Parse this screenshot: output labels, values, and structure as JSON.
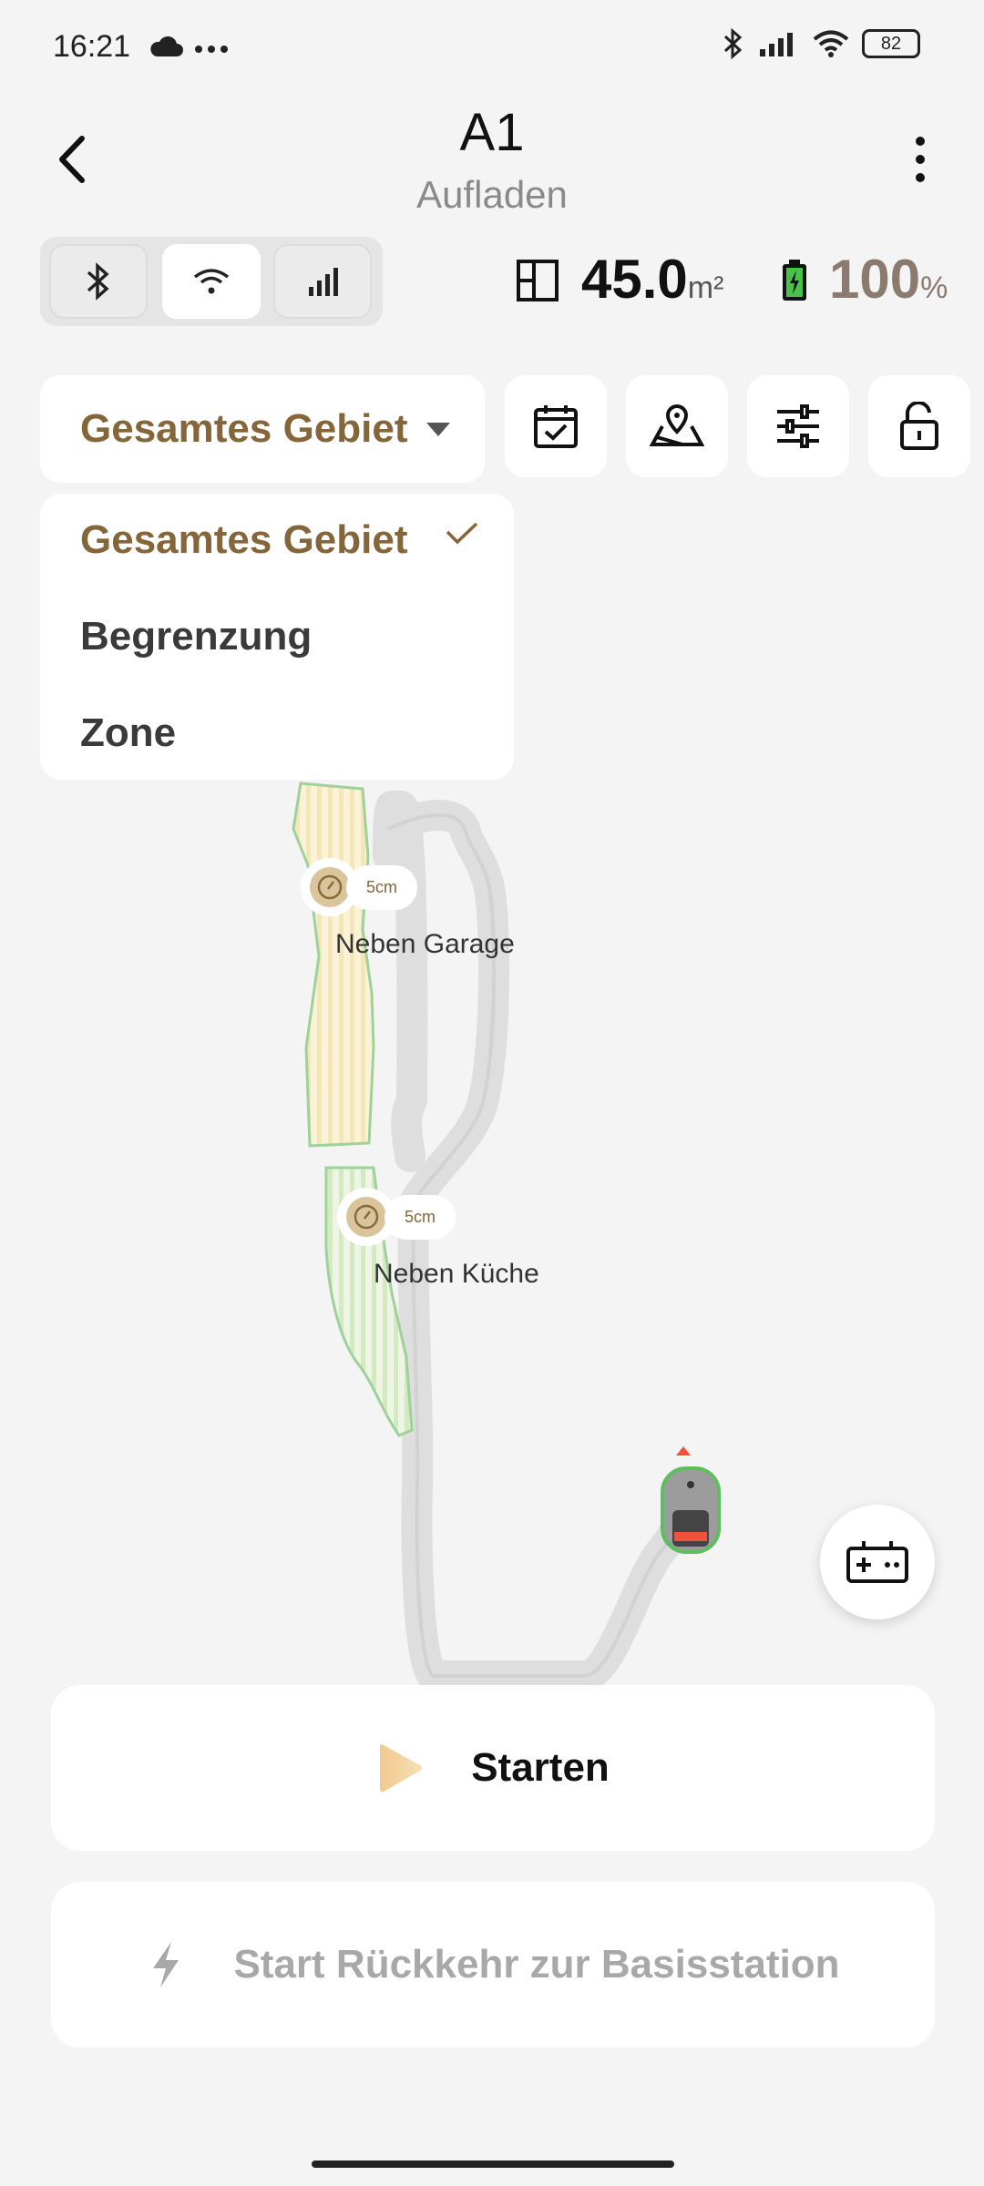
{
  "status_bar": {
    "time": "16:21",
    "battery": "82",
    "icons": [
      "cloud-icon",
      "more-dots-icon",
      "bluetooth-icon",
      "signal-icon",
      "wifi-icon",
      "battery-icon"
    ]
  },
  "header": {
    "title": "A1",
    "subtitle": "Aufladen"
  },
  "connection": {
    "modes": [
      "bluetooth",
      "wifi",
      "cellular"
    ],
    "active": "wifi"
  },
  "stats": {
    "area_value": "45.0",
    "area_unit": "m²",
    "battery_value": "100",
    "battery_unit": "%"
  },
  "toolbar": {
    "area_select_value": "Gesamtes Gebiet",
    "tools": [
      "schedule-icon",
      "map-edit-icon",
      "settings-sliders-icon",
      "unlock-icon"
    ]
  },
  "dropdown": {
    "options": [
      "Gesamtes Gebiet",
      "Begrenzung",
      "Zone"
    ],
    "selected": "Gesamtes Gebiet"
  },
  "map": {
    "zones": [
      {
        "name": "Neben Garage",
        "cut_height": "5cm"
      },
      {
        "name": "Neben Küche",
        "cut_height": "5cm"
      }
    ]
  },
  "actions": {
    "start_label": "Starten",
    "return_label": "Start Rückkehr zur Basisstation"
  },
  "colors": {
    "accent": "#85653a",
    "background": "#f4f4f4"
  }
}
